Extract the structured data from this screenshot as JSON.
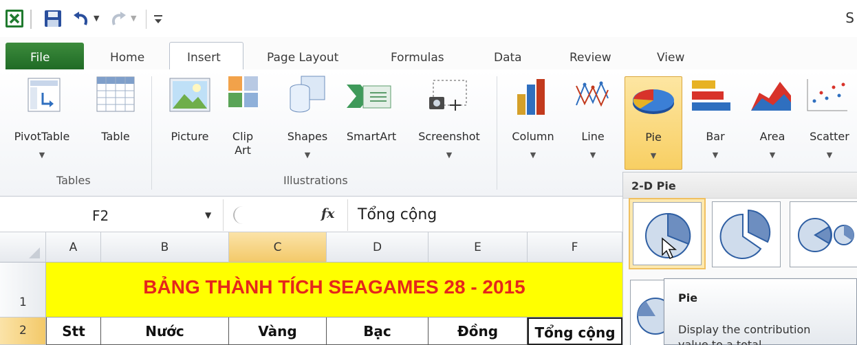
{
  "window": {
    "title_fragment": "S"
  },
  "tabs": [
    {
      "label": "File"
    },
    {
      "label": "Home"
    },
    {
      "label": "Insert"
    },
    {
      "label": "Page Layout"
    },
    {
      "label": "Formulas"
    },
    {
      "label": "Data"
    },
    {
      "label": "Review"
    },
    {
      "label": "View"
    }
  ],
  "ribbon": {
    "groups": {
      "tables": "Tables",
      "illustrations": "Illustrations"
    },
    "buttons": {
      "pivottable": "PivotTable",
      "table": "Table",
      "picture": "Picture",
      "clipart_1": "Clip",
      "clipart_2": "Art",
      "shapes": "Shapes",
      "smartart": "SmartArt",
      "screenshot": "Screenshot",
      "column": "Column",
      "line": "Line",
      "pie": "Pie",
      "bar": "Bar",
      "area": "Area",
      "scatter": "Scatter"
    },
    "dropdown_arrow": "▼"
  },
  "formula_bar": {
    "name_box": "F2",
    "fx": "fx",
    "formula": "Tổng cộng"
  },
  "grid": {
    "columns": [
      "A",
      "B",
      "C",
      "D",
      "E",
      "F"
    ],
    "rows": [
      "1",
      "2"
    ],
    "title": "BẢNG THÀNH TÍCH SEAGAMES 28 - 2015",
    "headers": [
      "Stt",
      "Nước",
      "Vàng",
      "Bạc",
      "Đồng",
      "Tổng cộng"
    ]
  },
  "pie_dropdown": {
    "section_title": "2-D Pie",
    "tooltip_title": "Pie",
    "tooltip_desc_1": "Display the contribution",
    "tooltip_desc_2": "value to a total"
  },
  "colors": {
    "file_tab": "#2b7a30",
    "title_fill": "#ffff00",
    "title_text": "#e5271b",
    "active_button": "#f8cf63"
  }
}
